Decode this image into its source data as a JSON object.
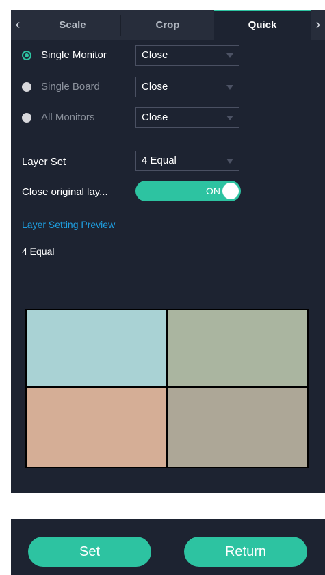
{
  "tabs": [
    {
      "label": "Scale",
      "active": false
    },
    {
      "label": "Crop",
      "active": false
    },
    {
      "label": "Quick",
      "active": true
    }
  ],
  "monitor_options": [
    {
      "label": "Single Monitor",
      "selected": true,
      "value": "Close"
    },
    {
      "label": "Single Board",
      "selected": false,
      "value": "Close"
    },
    {
      "label": "All Monitors",
      "selected": false,
      "value": "Close"
    }
  ],
  "layer_set": {
    "label": "Layer Set",
    "value": "4 Equal"
  },
  "close_original": {
    "label": "Close original lay...",
    "toggle_text": "ON",
    "on": true
  },
  "preview": {
    "title": "Layer Setting Preview",
    "name": "4 Equal",
    "cells": [
      {
        "color": "#a9d2d4"
      },
      {
        "color": "#aab5a0"
      },
      {
        "color": "#d5ae96"
      },
      {
        "color": "#ada797"
      }
    ]
  },
  "buttons": {
    "set": "Set",
    "return": "Return"
  },
  "colors": {
    "accent": "#2dc3a1",
    "link": "#1e9ee0",
    "panel_bg": "#1d2331"
  }
}
